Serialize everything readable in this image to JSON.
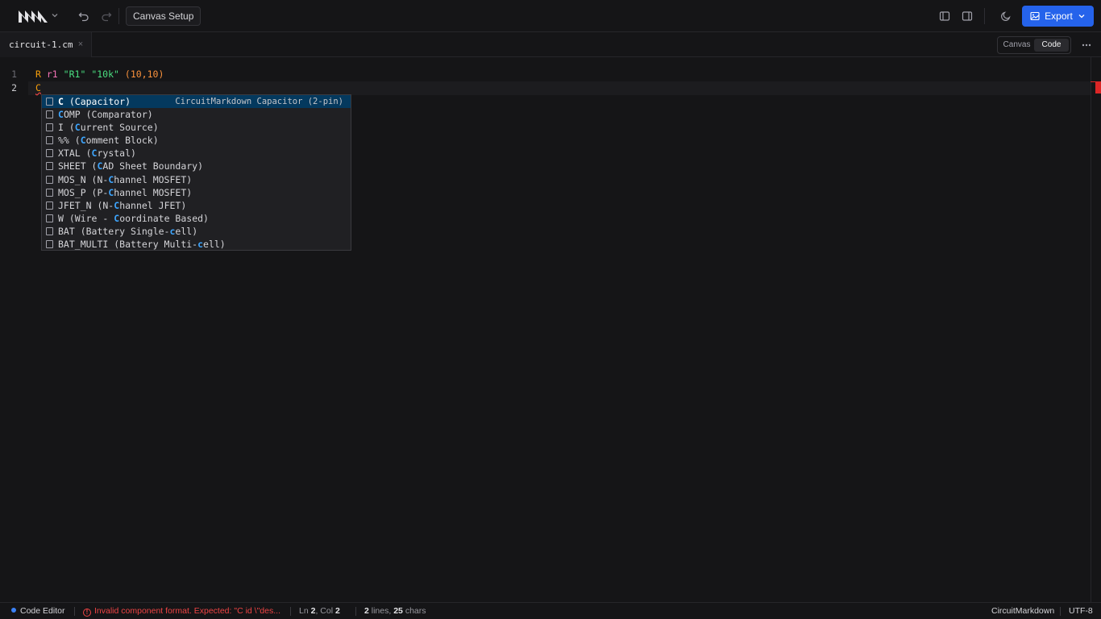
{
  "toolbar": {
    "canvas_setup_label": "Canvas Setup",
    "export_label": "Export",
    "icons": [
      "logo",
      "chevron-down-icon",
      "undo-icon",
      "redo-icon",
      "left-panel-icon",
      "right-panel-icon",
      "moon-icon",
      "image-icon"
    ]
  },
  "tabs": {
    "file_name": "circuit-1.cm",
    "close_symbol": "×",
    "view_options": [
      "Canvas",
      "Code"
    ],
    "active_view": "Code"
  },
  "editor": {
    "line_numbers": [
      "1",
      "2"
    ],
    "line1": {
      "kw": "R",
      "id": "r1",
      "str1": "\"R1\"",
      "str2": "\"10k\"",
      "paren_open": "(",
      "num1": "10",
      "comma": ",",
      "num2": "10",
      "paren_close": ")"
    },
    "line2": {
      "text": "C"
    }
  },
  "suggestions": [
    {
      "pre": "",
      "hl": "C",
      "post": " (Capacitor)",
      "detail": "CircuitMarkdown Capacitor (2-pin)",
      "selected": true
    },
    {
      "pre": "",
      "hl": "C",
      "post": "OMP (Comparator)"
    },
    {
      "pre": "I (",
      "hl": "C",
      "post": "urrent Source)"
    },
    {
      "pre": "%% (",
      "hl": "C",
      "post": "omment Block)"
    },
    {
      "pre": "XTAL (",
      "hl": "C",
      "post": "rystal)"
    },
    {
      "pre": "SHEET (",
      "hl": "C",
      "post": "AD Sheet Boundary)"
    },
    {
      "pre": "MOS_N (N-",
      "hl": "C",
      "post": "hannel MOSFET)"
    },
    {
      "pre": "MOS_P (P-",
      "hl": "C",
      "post": "hannel MOSFET)"
    },
    {
      "pre": "JFET_N (N-",
      "hl": "C",
      "post": "hannel JFET)"
    },
    {
      "pre": "W (Wire - ",
      "hl": "C",
      "post": "oordinate Based)"
    },
    {
      "pre": "BAT (Battery Single-",
      "hl": "c",
      "post": "ell)"
    },
    {
      "pre": "BAT_MULTI (Battery Multi-",
      "hl": "c",
      "post": "ell)"
    }
  ],
  "statusbar": {
    "mode": "Code Editor",
    "error": "Invalid component format. Expected: \"C id \\\"des...",
    "ln_label": "Ln",
    "ln": "2",
    "col_label": ", Col",
    "col": "2",
    "lines_count": "2",
    "lines_label": "lines,",
    "chars_count": "25",
    "chars_label": "chars",
    "language": "CircuitMarkdown",
    "encoding": "UTF-8"
  },
  "colors": {
    "accent": "#2563eb",
    "error": "#ef4444",
    "selection": "#04395e"
  }
}
